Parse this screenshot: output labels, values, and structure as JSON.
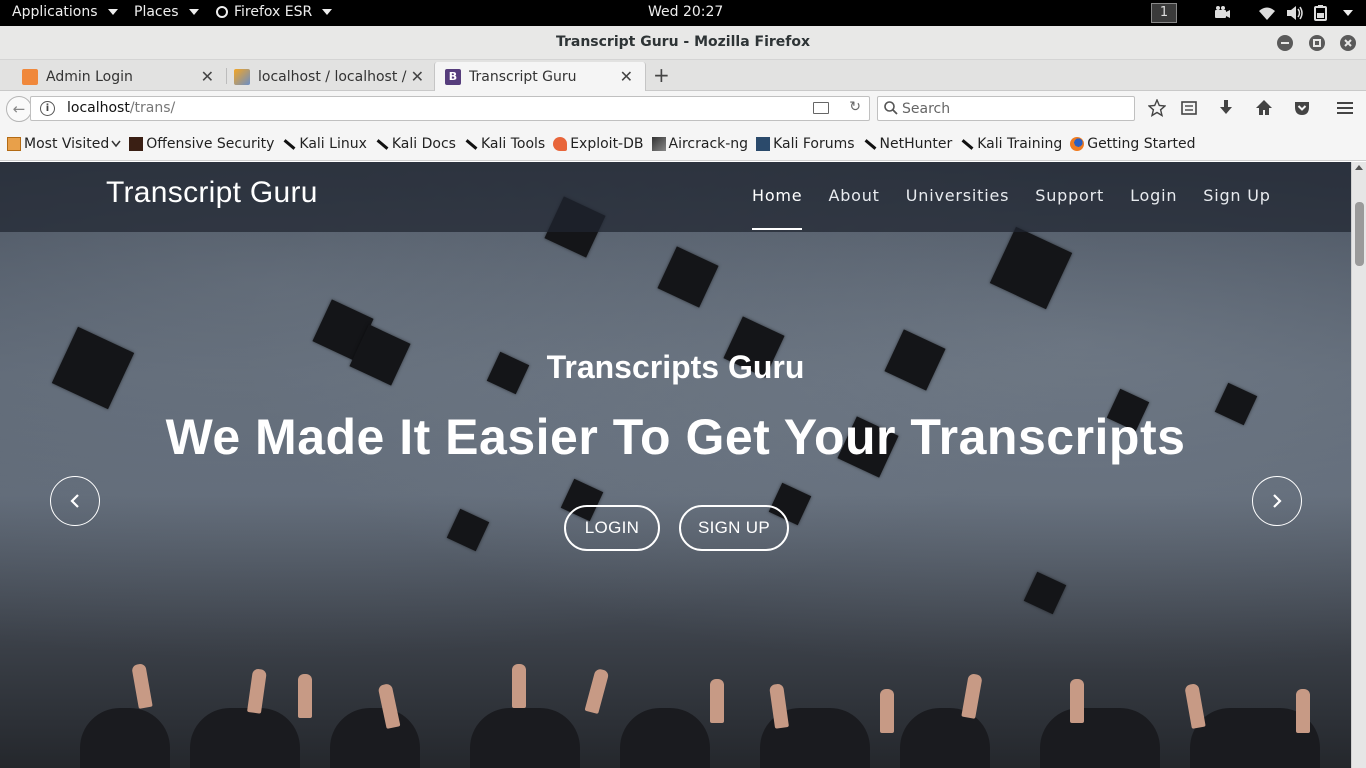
{
  "system_bar": {
    "applications": "Applications",
    "places": "Places",
    "firefox": "Firefox ESR",
    "clock": "Wed 20:27",
    "workspace": "1"
  },
  "window": {
    "title": "Transcript Guru - Mozilla Firefox"
  },
  "tabs": [
    {
      "label": "Admin Login",
      "active": false
    },
    {
      "label": "localhost / localhost /...",
      "active": false
    },
    {
      "label": "Transcript Guru",
      "active": true
    }
  ],
  "urlbar": {
    "host": "localhost",
    "path": "/trans/"
  },
  "searchbar": {
    "placeholder": "Search"
  },
  "bookmarks": [
    {
      "label": "Most Visited",
      "icon": "most-visited-icon"
    },
    {
      "label": "Offensive Security",
      "icon": "offensive-security-icon"
    },
    {
      "label": "Kali Linux",
      "icon": "kali-icon"
    },
    {
      "label": "Kali Docs",
      "icon": "kali-icon"
    },
    {
      "label": "Kali Tools",
      "icon": "kali-icon"
    },
    {
      "label": "Exploit-DB",
      "icon": "exploit-db-icon"
    },
    {
      "label": "Aircrack-ng",
      "icon": "aircrack-icon"
    },
    {
      "label": "Kali Forums",
      "icon": "kali-forums-icon"
    },
    {
      "label": "NetHunter",
      "icon": "kali-icon"
    },
    {
      "label": "Kali Training",
      "icon": "kali-icon"
    },
    {
      "label": "Getting Started",
      "icon": "firefox-icon"
    }
  ],
  "site": {
    "brand": "Transcript Guru",
    "menu": [
      {
        "label": "Home",
        "active": true
      },
      {
        "label": "About",
        "active": false
      },
      {
        "label": "Universities",
        "active": false
      },
      {
        "label": "Support",
        "active": false
      },
      {
        "label": "Login",
        "active": false
      },
      {
        "label": "Sign Up",
        "active": false
      }
    ],
    "hero": {
      "subtitle": "Transcripts Guru",
      "title": "We Made It Easier To Get Your Transcripts",
      "login_button": "LOGIN",
      "signup_button": "SIGN UP"
    }
  },
  "colors": {
    "system_bar": "#000000",
    "site_nav": "#202630",
    "hero_text": "#ffffff"
  }
}
